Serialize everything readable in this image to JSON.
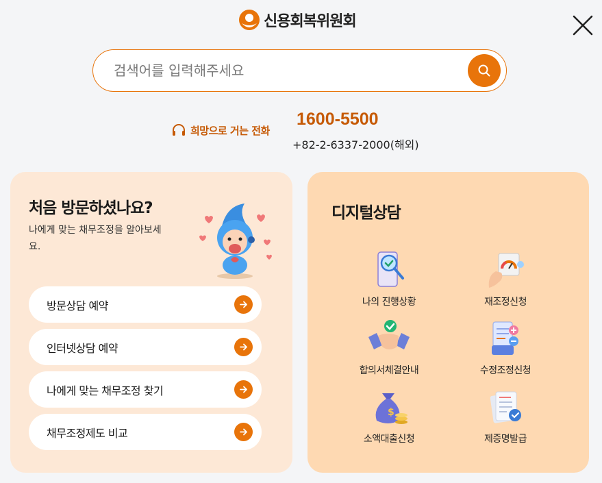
{
  "header": {
    "logo_text": "신용회복위원회",
    "close_icon": "close-icon"
  },
  "search": {
    "placeholder": "검색어를 입력해주세요",
    "value": "",
    "button_icon": "search-icon"
  },
  "hotline": {
    "label": "희망으로 거는 전화",
    "icon": "headset-icon",
    "number": "1600-5500",
    "international": "+82-2-6337-2000(해외)"
  },
  "first_visit": {
    "title": "처음 방문하셨나요?",
    "description": "나에게 맞는 채무조정을 알아보세요.",
    "buttons": [
      {
        "label": "방문상담 예약"
      },
      {
        "label": "인터넷상담 예약"
      },
      {
        "label": "나에게 맞는 채무조정 찾기"
      },
      {
        "label": "채무조정제도 비교"
      }
    ]
  },
  "digital": {
    "title": "디지털상담",
    "items": [
      {
        "label": "나의 진행상황",
        "icon": "magnifier-check-icon"
      },
      {
        "label": "재조정신청",
        "icon": "gauge-puzzle-icon"
      },
      {
        "label": "합의서체결안내",
        "icon": "handshake-icon"
      },
      {
        "label": "수정조정신청",
        "icon": "document-edit-icon"
      },
      {
        "label": "소액대출신청",
        "icon": "money-bag-icon"
      },
      {
        "label": "제증명발급",
        "icon": "certificate-icon"
      }
    ]
  },
  "colors": {
    "accent": "#e8740a",
    "hotline": "#c65a06",
    "card_left_bg": "#fde8d6",
    "card_right_bg": "#fed9b2",
    "page_bg": "#f4f5f7"
  }
}
